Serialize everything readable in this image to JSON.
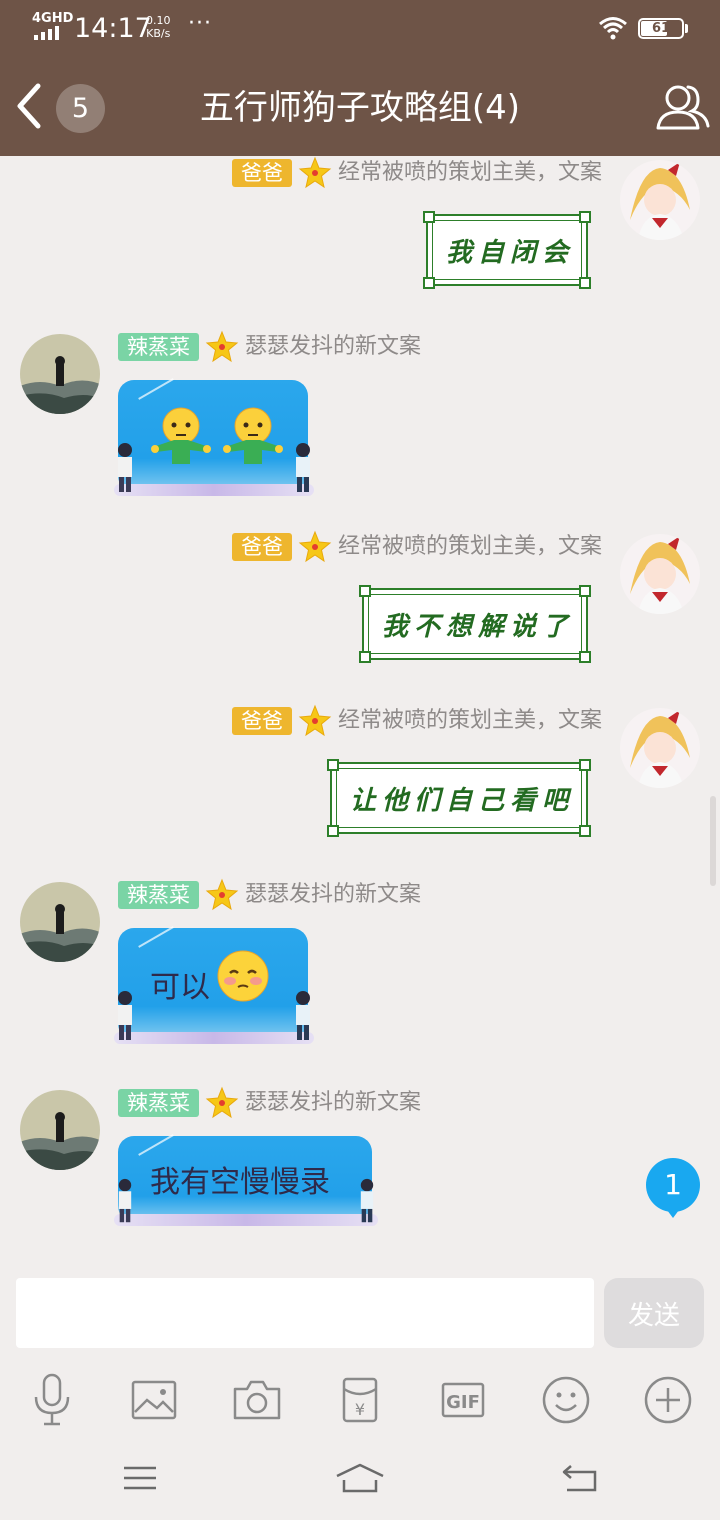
{
  "status_bar": {
    "network": "4GHD",
    "time": "14:17",
    "speed_value": "0.10",
    "speed_unit": "KB/s",
    "more": "···",
    "battery": "61"
  },
  "header": {
    "back_icon": "chevron-left-icon",
    "unread_count": "5",
    "title": "五行师狗子攻略组(4)",
    "profile_icon": "group-members-icon"
  },
  "messages": [
    {
      "side": "right",
      "badge": "爸爸",
      "badge_color": "#eeb62e",
      "title": "经常被喷的策划主美，文案",
      "type": "framed-text",
      "text": "我自闭会"
    },
    {
      "side": "left",
      "badge": "辣蒸菜",
      "badge_color": "#7ad4a5",
      "title": "瑟瑟发抖的新文案",
      "type": "emoji",
      "emoji": [
        "blank-face-shrug-icon",
        "blank-face-shrug-icon"
      ]
    },
    {
      "side": "right",
      "badge": "爸爸",
      "badge_color": "#eeb62e",
      "title": "经常被喷的策划主美，文案",
      "type": "framed-text",
      "text": "我不想解说了"
    },
    {
      "side": "right",
      "badge": "爸爸",
      "badge_color": "#eeb62e",
      "title": "经常被喷的策划主美，文案",
      "type": "framed-text",
      "text": "让他们自己看吧"
    },
    {
      "side": "left",
      "badge": "辣蒸菜",
      "badge_color": "#7ad4a5",
      "title": "瑟瑟发抖的新文案",
      "type": "text",
      "text": "可以",
      "emoji": [
        "shy-face-icon"
      ]
    },
    {
      "side": "left",
      "badge": "辣蒸菜",
      "badge_color": "#7ad4a5",
      "title": "瑟瑟发抖的新文案",
      "type": "text",
      "text": "我有空慢慢录"
    }
  ],
  "new_messages_count": "1",
  "composer": {
    "placeholder": "",
    "send_label": "发送"
  },
  "toolbar": [
    "microphone-icon",
    "image-icon",
    "camera-icon",
    "red-envelope-icon",
    "gif-icon",
    "emoji-icon",
    "plus-icon"
  ],
  "navbar": [
    "menu-icon",
    "home-icon",
    "back-icon"
  ],
  "colors": {
    "header_bg": "#6e5447",
    "chat_bg": "#f1eeed",
    "frame_green": "#2d7f2a",
    "bubble_blue": "#22a0e9",
    "badge_gold": "#eeb62e",
    "badge_green": "#7ad4a5",
    "new_msg_blue": "#19a8f0"
  }
}
